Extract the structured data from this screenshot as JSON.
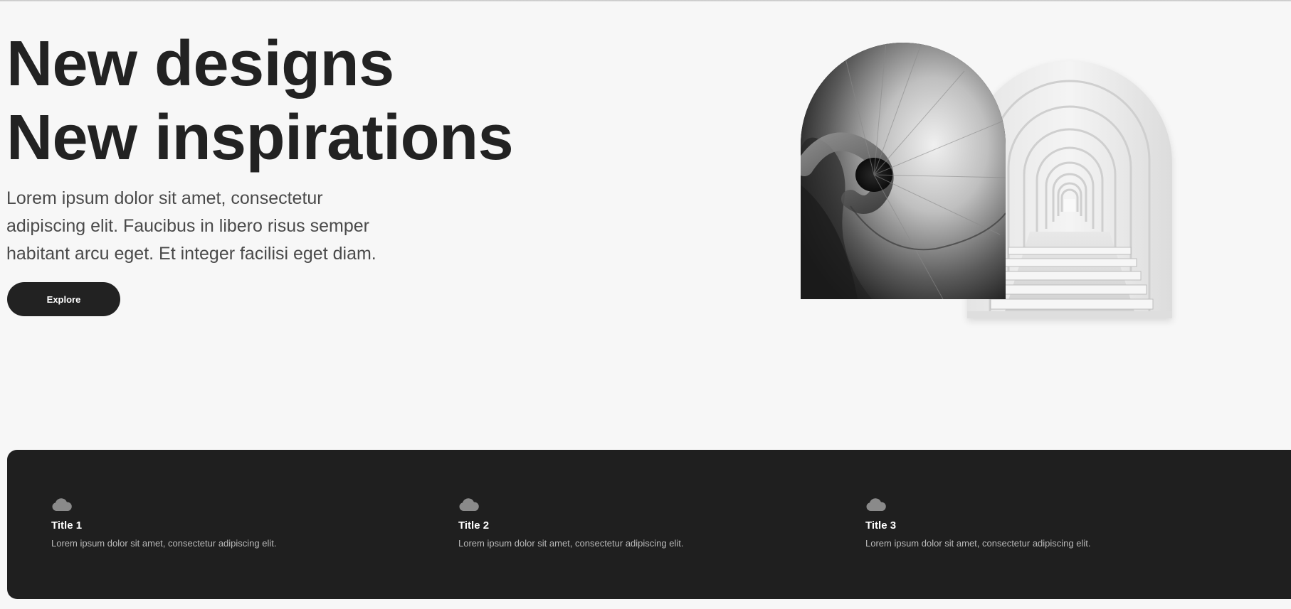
{
  "hero": {
    "title_line1": "New designs",
    "title_line2": "New inspirations",
    "description": "Lorem ipsum dolor sit amet, consectetur adipiscing elit. Faucibus in libero risus semper habitant arcu eget. Et integer facilisi eget diam.",
    "button_label": "Explore"
  },
  "features": [
    {
      "icon": "cloud-icon",
      "title": "Title 1",
      "text": "Lorem ipsum dolor sit amet, consectetur adipiscing elit."
    },
    {
      "icon": "cloud-icon",
      "title": "Title 2",
      "text": "Lorem ipsum dolor sit amet, consectetur adipiscing elit."
    },
    {
      "icon": "cloud-icon",
      "title": "Title 3",
      "text": "Lorem ipsum dolor sit amet, consectetur adipiscing elit."
    }
  ],
  "colors": {
    "background": "#f7f7f7",
    "text_dark": "#222222",
    "panel": "#1f1f1f",
    "muted_text": "#b9b9b9",
    "icon": "#8a8a8a"
  }
}
